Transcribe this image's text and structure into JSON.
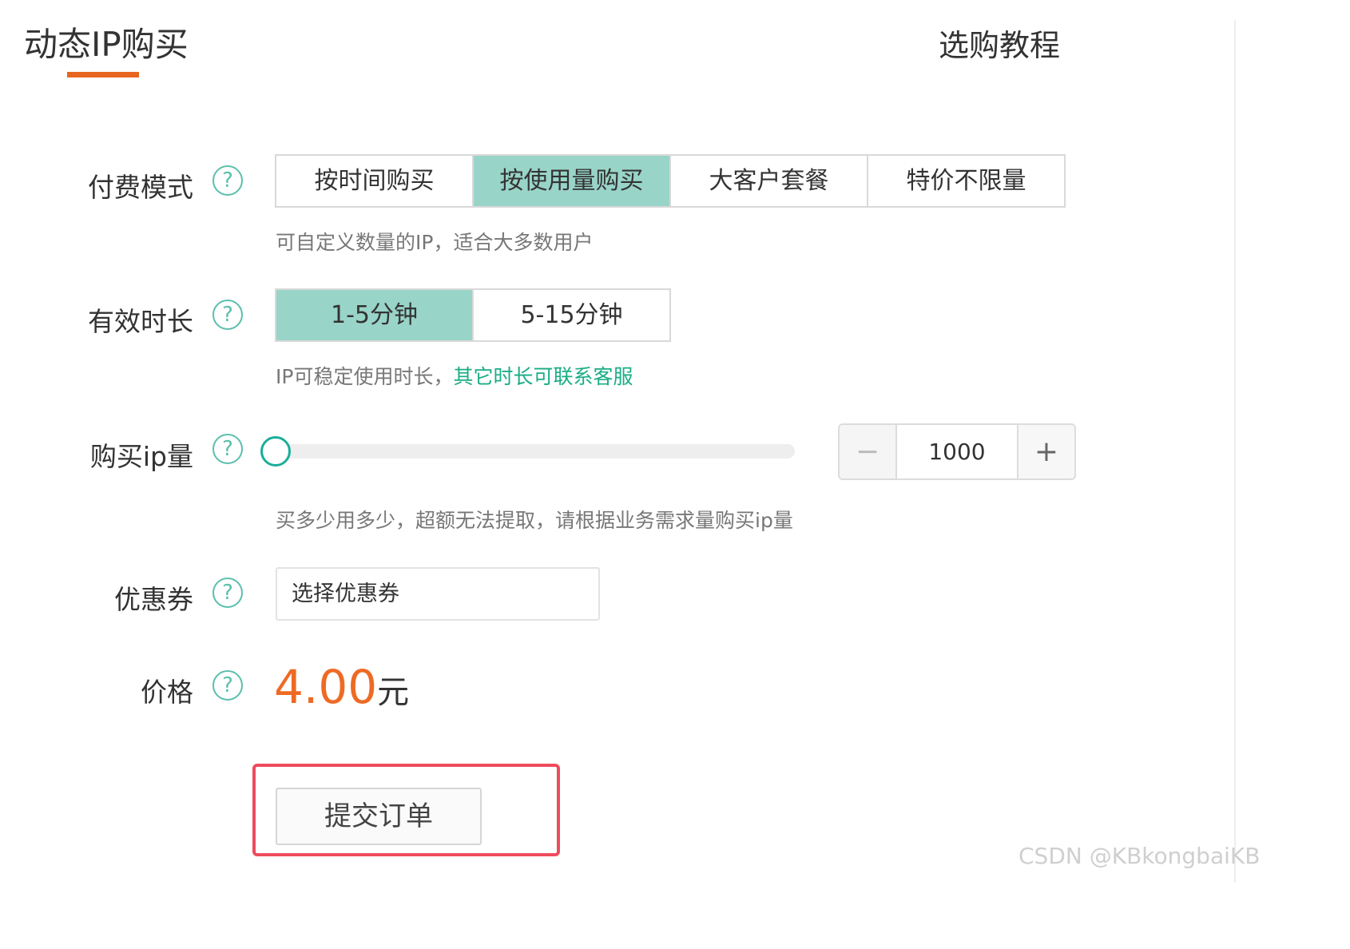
{
  "header": {
    "title": "动态IP购买",
    "tutorial_link": "选购教程"
  },
  "payment_mode": {
    "label": "付费模式",
    "help": "?",
    "options": [
      "按时间购买",
      "按使用量购买",
      "大客户套餐",
      "特价不限量"
    ],
    "selected": "按使用量购买",
    "hint": "可自定义数量的IP，适合大多数用户"
  },
  "duration": {
    "label": "有效时长",
    "help": "?",
    "options": [
      "1-5分钟",
      "5-15分钟"
    ],
    "selected": "1-5分钟",
    "hint": "IP可稳定使用时长，",
    "hint_link": "其它时长可联系客服"
  },
  "ip_quantity": {
    "label": "购买ip量",
    "help": "?",
    "slider_level": 0,
    "minus": "−",
    "value": "1000",
    "plus": "+",
    "hint": "买多少用多少，超额无法提取，请根据业务需求量购买ip量"
  },
  "coupon": {
    "label": "优惠券",
    "help": "?",
    "placeholder": "选择优惠券"
  },
  "price": {
    "label": "价格",
    "help": "?",
    "amount": "4.00",
    "unit": "元"
  },
  "submit": {
    "label": "提交订单"
  },
  "watermark": "CSDN @KBkongbaiKB",
  "colors": {
    "accent_orange": "#e8651e",
    "active_segment": "#99d4c8",
    "help_icon": "#5bbfac",
    "link_green": "#1aad86",
    "highlight_red": "#ee4b5d"
  }
}
